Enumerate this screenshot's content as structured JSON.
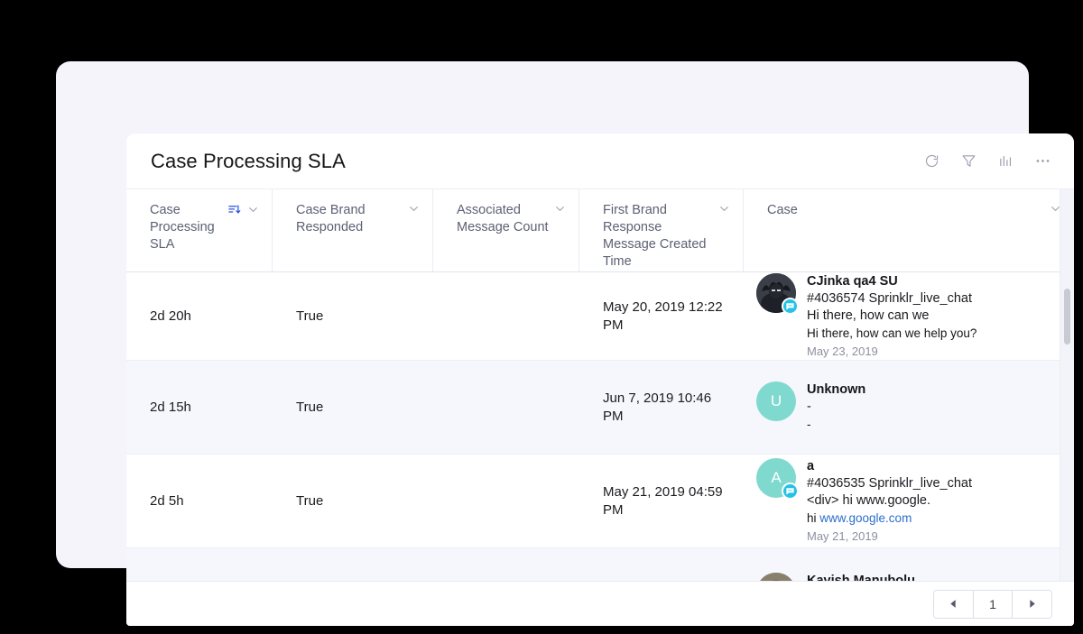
{
  "widget": {
    "title": "Case Processing SLA",
    "actions": [
      {
        "name": "refresh-icon",
        "label": "Refresh"
      },
      {
        "name": "filter-icon",
        "label": "Filter"
      },
      {
        "name": "chart-icon",
        "label": "Chart view"
      },
      {
        "name": "more-options-icon",
        "label": "More options"
      }
    ]
  },
  "table": {
    "columns": [
      {
        "label": "Case Processing SLA",
        "sorted": true,
        "sort_direction": "descending",
        "sort_color": "#2b52e0"
      },
      {
        "label": "Case Brand Responded",
        "sorted": false
      },
      {
        "label": "Associated Message Count",
        "sorted": false
      },
      {
        "label": "First Brand Response Message Created Time",
        "sorted": false
      },
      {
        "label": "Case",
        "sorted": false
      }
    ],
    "rows": [
      {
        "sla": "2d 20h",
        "brand_responded": "True",
        "message_count": "",
        "first_response_time": "May 20, 2019 12:22 PM",
        "case": {
          "avatar_type": "photo",
          "avatar_initial": "",
          "name": "CJinka qa4 SU",
          "meta": "#4036574 Sprinklr_live_chat",
          "meta2": "Hi there, how can we",
          "snippet": "Hi there, how can we help you?",
          "link_text": "",
          "date": "May 23, 2019",
          "badge": "chat-badge-icon"
        }
      },
      {
        "sla": "2d 15h",
        "brand_responded": "True",
        "message_count": "",
        "first_response_time": "Jun 7, 2019 10:46 PM",
        "case": {
          "avatar_type": "teal",
          "avatar_initial": "U",
          "name": "Unknown",
          "meta": "-",
          "meta2": "",
          "snippet": "-",
          "link_text": "",
          "date": "",
          "badge": ""
        }
      },
      {
        "sla": "2d 5h",
        "brand_responded": "True",
        "message_count": "",
        "first_response_time": "May 21, 2019 04:59 PM",
        "case": {
          "avatar_type": "teal",
          "avatar_initial": "A",
          "name": "a",
          "meta": "#4036535 Sprinklr_live_chat",
          "meta2": "<div> hi www.google.",
          "snippet": "hi ",
          "link_text": "www.google.com",
          "date": "May 21, 2019",
          "badge": "chat-badge-icon"
        }
      },
      {
        "sla": "",
        "brand_responded": "",
        "message_count": "",
        "first_response_time": "",
        "case": {
          "avatar_type": "photo2",
          "avatar_initial": "",
          "name": "Kavish Manubolu",
          "meta": "",
          "meta2": "",
          "snippet": "",
          "link_text": "",
          "date": "",
          "badge": ""
        }
      }
    ]
  },
  "pagination": {
    "prev_label": "Previous page",
    "next_label": "Next page",
    "current_page": "1"
  },
  "colors": {
    "accent": "#2b52e0",
    "link": "#2c6ecb",
    "badge": "#23c2e8",
    "avatar_teal": "#7fd9cf",
    "alt_row": "#f5f7fc"
  }
}
